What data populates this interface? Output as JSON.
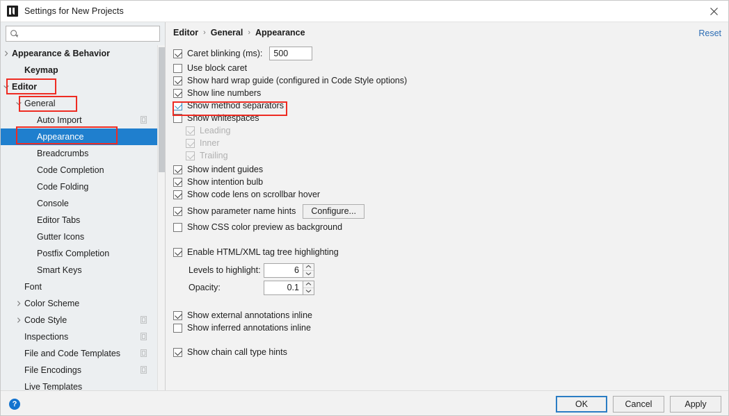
{
  "window": {
    "title": "Settings for New Projects",
    "app_icon": "intellij-idea-logo",
    "close_icon": "close-icon"
  },
  "search": {
    "icon": "search-icon",
    "value": "",
    "placeholder": ""
  },
  "sidebar": {
    "scrollbar": "vertical-scrollbar",
    "items": [
      {
        "label": "Appearance & Behavior",
        "indent": 0,
        "arrow": "chevron-right",
        "bold": true,
        "selected": false,
        "icon": ""
      },
      {
        "label": "Keymap",
        "indent": 1,
        "arrow": "",
        "bold": true,
        "selected": false,
        "icon": ""
      },
      {
        "label": "Editor",
        "indent": 0,
        "arrow": "chevron-down",
        "bold": true,
        "selected": false,
        "icon": ""
      },
      {
        "label": "General",
        "indent": 1,
        "arrow": "chevron-down",
        "bold": false,
        "selected": false,
        "icon": ""
      },
      {
        "label": "Auto Import",
        "indent": 2,
        "arrow": "",
        "bold": false,
        "selected": false,
        "icon": "copy-icon"
      },
      {
        "label": "Appearance",
        "indent": 2,
        "arrow": "",
        "bold": false,
        "selected": true,
        "icon": ""
      },
      {
        "label": "Breadcrumbs",
        "indent": 2,
        "arrow": "",
        "bold": false,
        "selected": false,
        "icon": ""
      },
      {
        "label": "Code Completion",
        "indent": 2,
        "arrow": "",
        "bold": false,
        "selected": false,
        "icon": ""
      },
      {
        "label": "Code Folding",
        "indent": 2,
        "arrow": "",
        "bold": false,
        "selected": false,
        "icon": ""
      },
      {
        "label": "Console",
        "indent": 2,
        "arrow": "",
        "bold": false,
        "selected": false,
        "icon": ""
      },
      {
        "label": "Editor Tabs",
        "indent": 2,
        "arrow": "",
        "bold": false,
        "selected": false,
        "icon": ""
      },
      {
        "label": "Gutter Icons",
        "indent": 2,
        "arrow": "",
        "bold": false,
        "selected": false,
        "icon": ""
      },
      {
        "label": "Postfix Completion",
        "indent": 2,
        "arrow": "",
        "bold": false,
        "selected": false,
        "icon": ""
      },
      {
        "label": "Smart Keys",
        "indent": 2,
        "arrow": "",
        "bold": false,
        "selected": false,
        "icon": ""
      },
      {
        "label": "Font",
        "indent": 1,
        "arrow": "",
        "bold": false,
        "selected": false,
        "icon": ""
      },
      {
        "label": "Color Scheme",
        "indent": 1,
        "arrow": "chevron-right",
        "bold": false,
        "selected": false,
        "icon": ""
      },
      {
        "label": "Code Style",
        "indent": 1,
        "arrow": "chevron-right",
        "bold": false,
        "selected": false,
        "icon": "copy-icon"
      },
      {
        "label": "Inspections",
        "indent": 1,
        "arrow": "",
        "bold": false,
        "selected": false,
        "icon": "copy-icon"
      },
      {
        "label": "File and Code Templates",
        "indent": 1,
        "arrow": "",
        "bold": false,
        "selected": false,
        "icon": "copy-icon"
      },
      {
        "label": "File Encodings",
        "indent": 1,
        "arrow": "",
        "bold": false,
        "selected": false,
        "icon": "copy-icon"
      },
      {
        "label": "Live Templates",
        "indent": 1,
        "arrow": "",
        "bold": false,
        "selected": false,
        "icon": ""
      }
    ]
  },
  "content": {
    "breadcrumb": [
      "Editor",
      "General",
      "Appearance"
    ],
    "breadcrumb_separator": "›",
    "reset_label": "Reset",
    "caret_blinking": {
      "label": "Caret blinking (ms):",
      "checked": true,
      "value": "500"
    },
    "options": [
      {
        "label": "Use block caret",
        "checked": false,
        "disabled": false,
        "indent": 0
      },
      {
        "label": "Show hard wrap guide (configured in Code Style options)",
        "checked": true,
        "disabled": false,
        "indent": 0
      },
      {
        "label": "Show line numbers",
        "checked": true,
        "disabled": false,
        "indent": 0
      },
      {
        "label": "Show method separators",
        "checked": true,
        "disabled": false,
        "indent": 0,
        "highlighted": true
      },
      {
        "label": "Show whitespaces",
        "checked": false,
        "disabled": false,
        "indent": 0
      },
      {
        "label": "Leading",
        "checked": true,
        "disabled": true,
        "indent": 1
      },
      {
        "label": "Inner",
        "checked": true,
        "disabled": true,
        "indent": 1
      },
      {
        "label": "Trailing",
        "checked": true,
        "disabled": true,
        "indent": 1
      },
      {
        "label": "Show indent guides",
        "checked": true,
        "disabled": false,
        "indent": 0
      },
      {
        "label": "Show intention bulb",
        "checked": true,
        "disabled": false,
        "indent": 0
      },
      {
        "label": "Show code lens on scrollbar hover",
        "checked": true,
        "disabled": false,
        "indent": 0
      }
    ],
    "param_hints": {
      "label": "Show parameter name hints",
      "checked": true,
      "button_label": "Configure..."
    },
    "css_preview": {
      "label": "Show CSS color preview as background",
      "checked": false
    },
    "html_highlight": {
      "label": "Enable HTML/XML tag tree highlighting",
      "checked": true
    },
    "levels": {
      "label": "Levels to highlight:",
      "value": "6",
      "up_icon": "chevron-up-icon",
      "down_icon": "chevron-down-icon"
    },
    "opacity": {
      "label": "Opacity:",
      "value": "0.1",
      "up_icon": "chevron-up-icon",
      "down_icon": "chevron-down-icon"
    },
    "annotations": [
      {
        "label": "Show external annotations inline",
        "checked": true
      },
      {
        "label": "Show inferred annotations inline",
        "checked": false
      }
    ],
    "chain_hints": {
      "label": "Show chain call type hints",
      "checked": true
    }
  },
  "footer": {
    "help_icon": "help-icon",
    "help_glyph": "?",
    "ok_label": "OK",
    "cancel_label": "Cancel",
    "apply_label": "Apply"
  },
  "colors": {
    "selection_blue": "#1f7fce",
    "link_blue": "#2b6cb4",
    "annotation_red": "#ee2b22",
    "default_button_border": "#2b7dc4",
    "help_blue": "#1273cf"
  }
}
